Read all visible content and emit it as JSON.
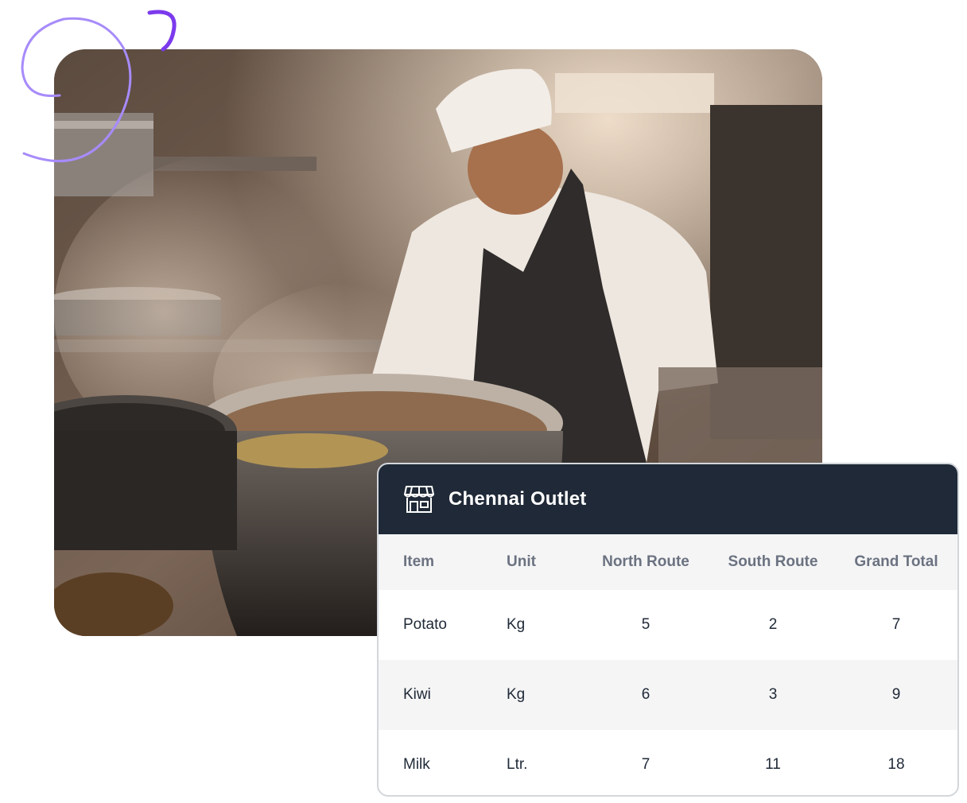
{
  "outlet": {
    "title": "Chennai Outlet",
    "icon": "store-icon"
  },
  "table": {
    "headers": [
      "Item",
      "Unit",
      "North Route",
      "South Route",
      "Grand Total"
    ],
    "rows": [
      {
        "item": "Potato",
        "unit": "Kg",
        "north": "5",
        "south": "2",
        "total": "7"
      },
      {
        "item": "Kiwi",
        "unit": "Kg",
        "north": "6",
        "south": "3",
        "total": "9"
      },
      {
        "item": "Milk",
        "unit": "Ltr.",
        "north": "7",
        "south": "11",
        "total": "18"
      }
    ]
  },
  "colors": {
    "header_bg": "#1f2937",
    "accent_swirl": "#8b5cf6",
    "muted_text": "#6b7280"
  }
}
